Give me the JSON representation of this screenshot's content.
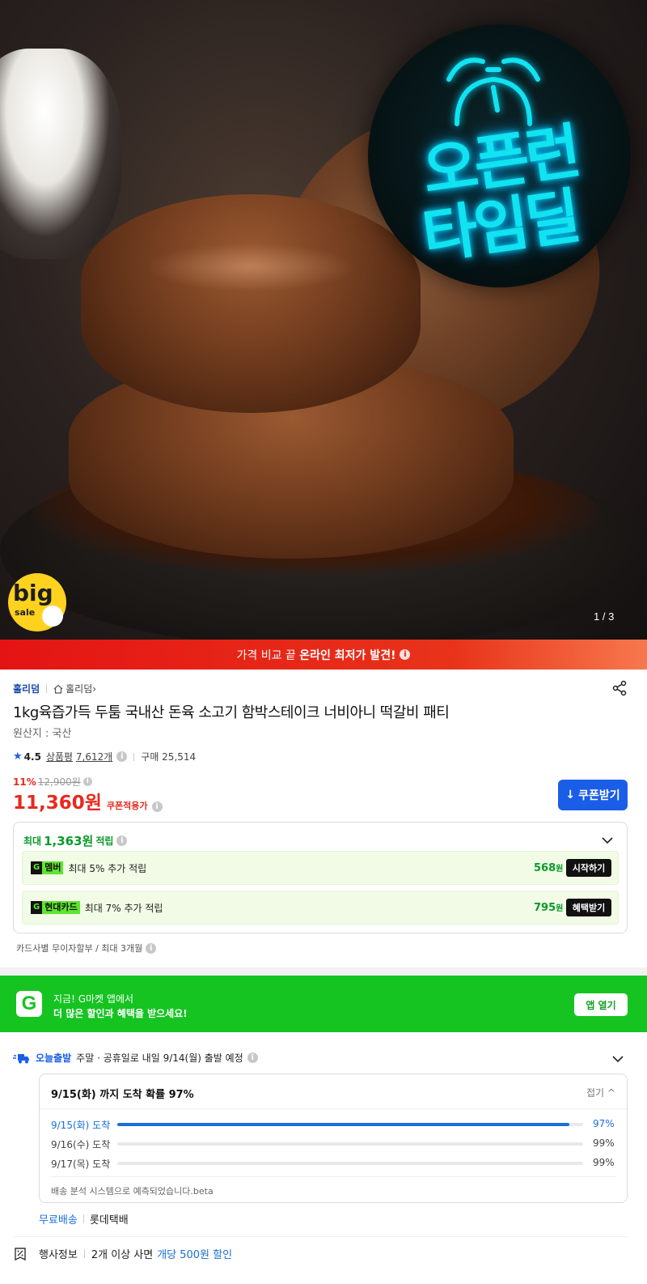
{
  "hero": {
    "timedeal_line1": "오픈런",
    "timedeal_line2": "타임딜",
    "badge_big": "big",
    "badge_sale": "sale",
    "slide_counter": "1 / 3"
  },
  "compare_bar": {
    "text_prefix": "가격 비교 끝 ",
    "text_bold": "온라인 최저가 발견!",
    "info": "i"
  },
  "product": {
    "seller": "홀리덤",
    "store_link": "홀리덤",
    "title": "1kg육즙가득 두툼 국내산 돈육 소고기 함박스테이크 너비아니 떡갈비 패티",
    "origin": "원산지 : 국산",
    "rating": "4.5",
    "review_label": "상품평",
    "review_count": "7,612개",
    "purchase": "구매 25,514",
    "discount_pct": "11%",
    "original_price": "12,900원",
    "price": "11,360원",
    "coupon_applied": "쿠폰적용가",
    "coupon_button": "쿠폰받기"
  },
  "points": {
    "prefix": "최대",
    "amount": "1,363원",
    "suffix": "적립",
    "rows": [
      {
        "tag_icon": "G",
        "tag_label": "멤버",
        "desc": "최대 5% 추가 적립",
        "pts": "568",
        "unit": "원",
        "action": "시작하기"
      },
      {
        "tag_icon": "G",
        "tag_label": "현대카드",
        "desc": "최대 7% 추가 적립",
        "pts": "795",
        "unit": "원",
        "action": "혜택받기"
      }
    ],
    "installment": "카드사별 무이자할부 / 최대 3개월"
  },
  "app_banner": {
    "logo": "G",
    "line1": "지금! G마켓 앱에서",
    "line2": "더 많은 할인과 혜택을 받으세요!",
    "open_button": "앱 열기"
  },
  "delivery": {
    "today_label": "오늘출발",
    "schedule": "주말 · 공휴일로 내일 9/14(월) 출발 예정",
    "eta_head": "9/15(화) 까지 도착 확률 97%",
    "fold": "접기 ^",
    "lines": [
      {
        "date": "9/15(화) 도착",
        "prob": "97%",
        "value": 0.97
      },
      {
        "date": "9/16(수) 도착",
        "prob": "99%",
        "value": 0
      },
      {
        "date": "9/17(목) 도착",
        "prob": "99%",
        "value": 0
      }
    ],
    "note": "배송 분석 시스템으로 예측되었습니다.beta",
    "free_shipping": "무료배송",
    "carrier": "롯데택배"
  },
  "promo": {
    "label": "행사정보",
    "text": "2개 이상 사면",
    "highlight": "개당 500원 할인"
  },
  "colors": {
    "brand_red": "#e8291e",
    "brand_blue": "#1a5ee8",
    "brand_green": "#15c421",
    "points_green": "#0b9a2a",
    "neon_cyan": "#11e3f0"
  }
}
